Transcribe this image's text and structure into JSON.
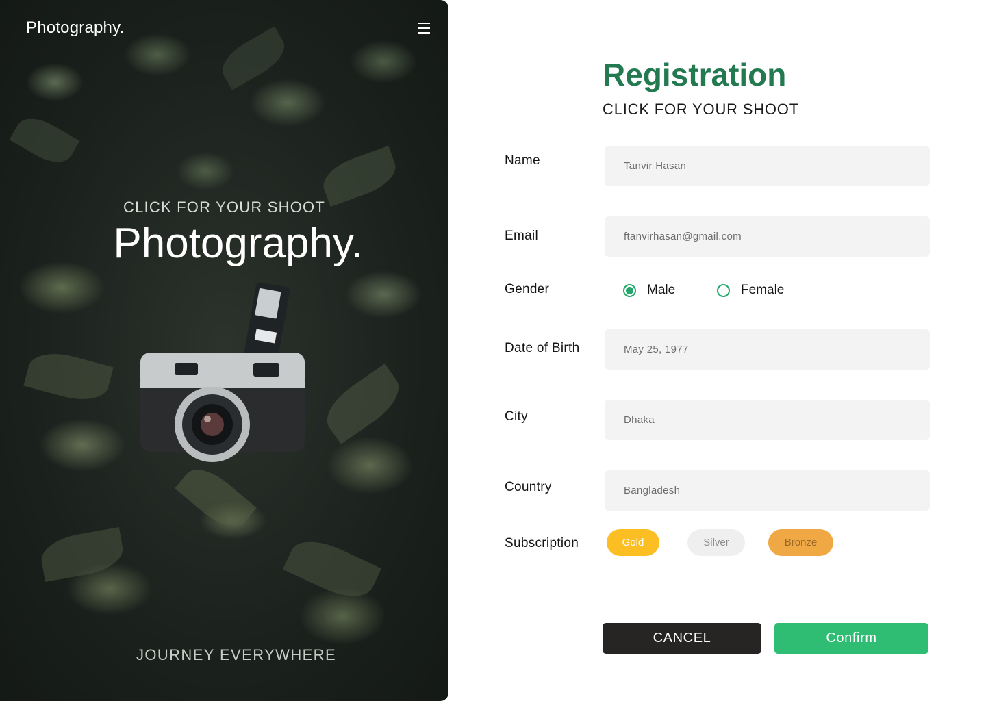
{
  "hero": {
    "brand": "Photography.",
    "tagline": "CLICK FOR YOUR SHOOT",
    "title": "Photography.",
    "footer": "JOURNEY EVERYWHERE",
    "menu_icon": "hamburger-menu-icon"
  },
  "form": {
    "title": "Registration",
    "subtitle": "CLICK FOR YOUR SHOOT",
    "title_color": "#237a51",
    "fields": {
      "name": {
        "label": "Name",
        "value": "Tanvir Hasan"
      },
      "email": {
        "label": "Email",
        "value": "ftanvirhasan@gmail.com"
      },
      "dob": {
        "label": "Date of Birth",
        "value": "May 25, 1977"
      },
      "city": {
        "label": "City",
        "value": "Dhaka"
      },
      "country": {
        "label": "Country",
        "value": "Bangladesh"
      }
    },
    "gender": {
      "label": "Gender",
      "options": [
        "Male",
        "Female"
      ],
      "selected": "Male"
    },
    "subscription": {
      "label": "Subscription",
      "options": [
        {
          "label": "Gold",
          "bg": "#fbbf24",
          "fg": "#ffffff"
        },
        {
          "label": "Silver",
          "bg": "#efefef",
          "fg": "#8a8a8a"
        },
        {
          "label": "Bronze",
          "bg": "#f0a845",
          "fg": "#9a6a2a"
        }
      ]
    },
    "actions": {
      "cancel": "CANCEL",
      "confirm": "Confirm",
      "cancel_bg": "#272424",
      "confirm_bg": "#2ebd72"
    }
  }
}
